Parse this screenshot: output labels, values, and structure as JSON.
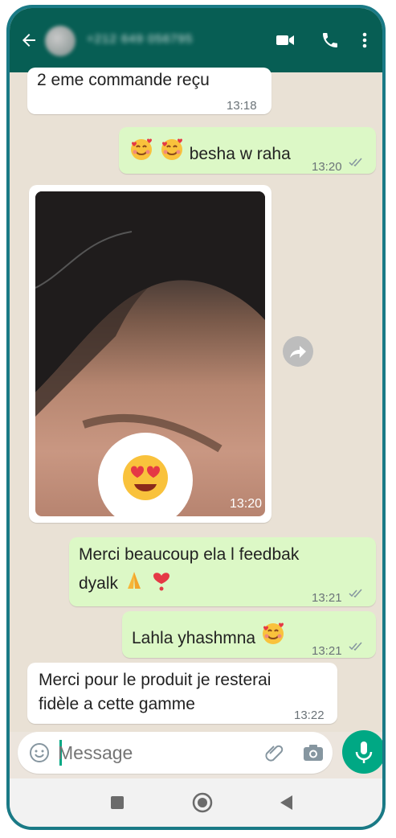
{
  "header": {
    "contact_name": "+212 649 056795",
    "icons": [
      "back-arrow-icon",
      "avatar",
      "video-call-icon",
      "phone-call-icon",
      "more-vertical-icon"
    ]
  },
  "messages": [
    {
      "direction": "in",
      "text": "2 eme commande reçu",
      "time": "13:18"
    },
    {
      "direction": "out",
      "text": "besha w raha",
      "emoji": "smiling-face-with-hearts x2",
      "time": "13:20",
      "status": "read"
    },
    {
      "direction": "in",
      "type": "image",
      "time": "13:20",
      "reaction": "heart-eyes-emoji"
    },
    {
      "direction": "out",
      "text_line1": "Merci beaucoup ela l feedbak",
      "text_line2": "dyalk",
      "emoji": "folded-hands, heart-exclamation",
      "time": "13:21",
      "status": "read"
    },
    {
      "direction": "out",
      "text": "Lahla yhashmna",
      "emoji": "smiling-face-with-hearts",
      "time": "13:21",
      "status": "read"
    },
    {
      "direction": "in",
      "text_line1": "Merci pour le produit je resterai",
      "text_line2": "fidèle a cette gamme",
      "time": "13:22"
    }
  ],
  "compose": {
    "placeholder": "Message"
  },
  "colors": {
    "header": "#075e54",
    "outgoing": "#dcf8c6",
    "incoming": "#ffffff",
    "accent": "#00a884",
    "background": "#e9e1d5"
  }
}
